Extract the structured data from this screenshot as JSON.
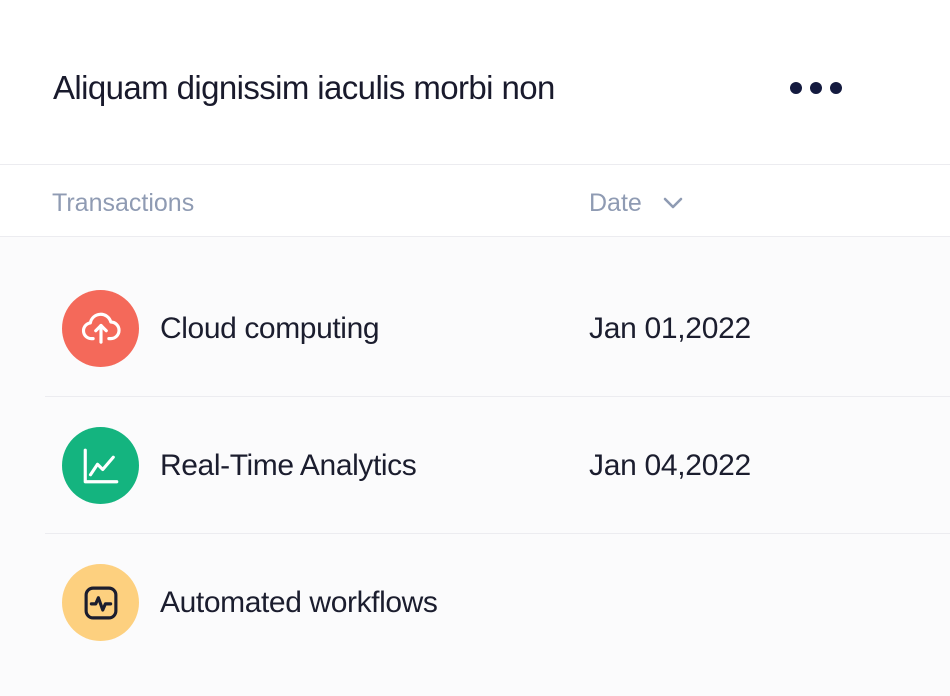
{
  "header": {
    "title": "Aliquam dignissim iaculis morbi non",
    "more_icon": "more-horizontal-icon"
  },
  "columns": {
    "transactions": "Transactions",
    "date": "Date",
    "sort_icon": "chevron-down-icon"
  },
  "colors": {
    "cloud": "#f4695a",
    "analytics": "#14b47f",
    "workflows": "#fdd07f"
  },
  "rows": [
    {
      "name": "Cloud computing",
      "date": "Jan 01,2022",
      "icon": "cloud-upload-icon"
    },
    {
      "name": "Real-Time Analytics",
      "date": "Jan 04,2022",
      "icon": "line-chart-icon"
    },
    {
      "name": "Automated workflows",
      "date": "",
      "icon": "activity-icon"
    }
  ]
}
